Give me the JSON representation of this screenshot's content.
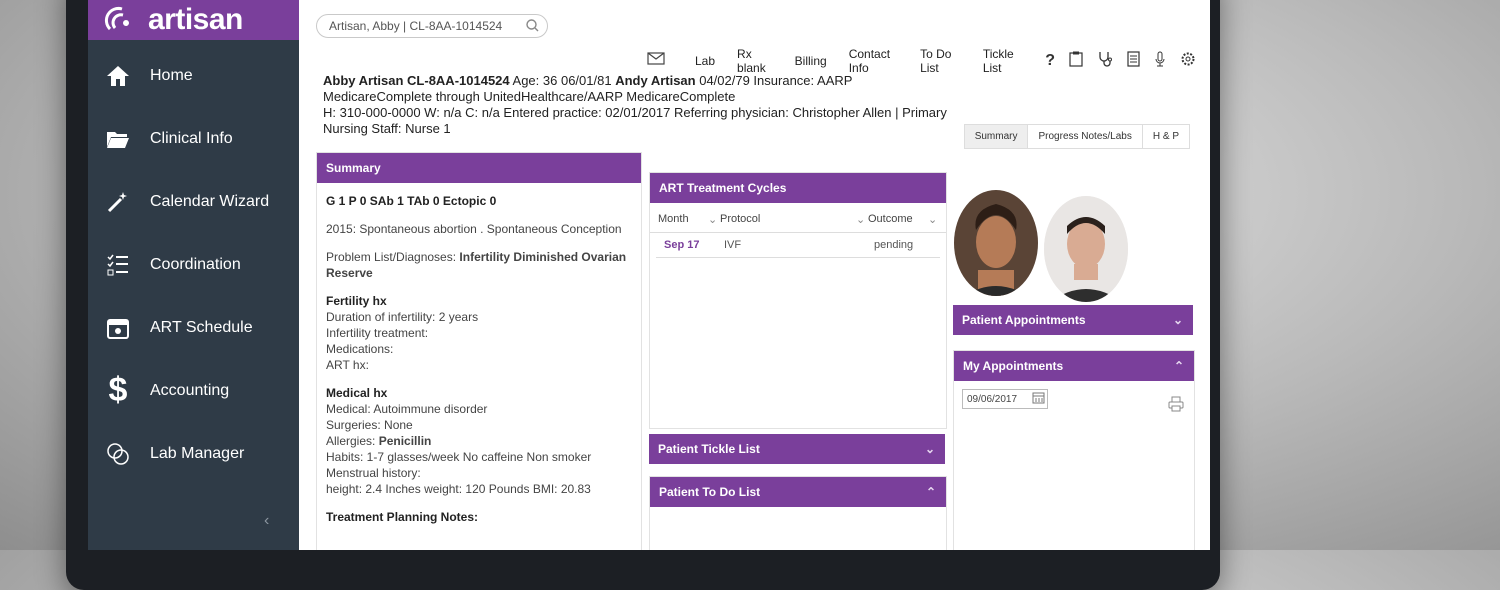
{
  "app": {
    "logo_text": "artisan",
    "accent": "#7a3f9b",
    "sidebar_bg": "#2f3b47"
  },
  "sidebar": {
    "items": [
      {
        "label": "Home",
        "icon": "home-icon"
      },
      {
        "label": "Clinical Info",
        "icon": "folder-icon"
      },
      {
        "label": "Calendar Wizard",
        "icon": "magic-wand-icon"
      },
      {
        "label": "Coordination",
        "icon": "checklist-icon"
      },
      {
        "label": "ART Schedule",
        "icon": "calendar-icon"
      },
      {
        "label": "Accounting",
        "icon": "dollar-icon"
      },
      {
        "label": "Lab Manager",
        "icon": "lab-icon"
      }
    ],
    "collapse_glyph": "‹"
  },
  "search": {
    "value": "Artisan, Abby | CL-8AA-1014524"
  },
  "topnav": {
    "items": [
      "Lab",
      "Rx blank",
      "Billing",
      "Contact Info",
      "To Do List",
      "Tickle List"
    ],
    "help": "?"
  },
  "patient": {
    "name_id": "Abby Artisan CL-8AA-1014524",
    "age_dob": " Age: 36 06/01/81 ",
    "partner": "Andy Artisan",
    "partner_dob_ins": " 04/02/79 Insurance: AARP",
    "line2": "MedicareComplete through UnitedHealthcare/AARP MedicareComplete",
    "line3": "H: 310-000-0000 W: n/a C: n/a Entered practice: 02/01/2017 Referring physician: Christopher Allen | Primary",
    "line4": "Nursing Staff: Nurse 1"
  },
  "view_tabs": [
    "Summary",
    "Progress Notes/Labs",
    "H & P"
  ],
  "summary": {
    "title": "Summary",
    "gravida": "G 1 P 0 SAb 1 TAb 0 Ectopic 0",
    "history": "2015: Spontaneous abortion . Spontaneous Conception",
    "problem_label": "Problem List/Diagnoses: ",
    "problem_value": "Infertility   Diminished Ovarian Reserve",
    "fertility_title": "Fertility hx",
    "fertility_lines": [
      "Duration of infertility: 2 years",
      "Infertility treatment:",
      "Medications:",
      "ART hx:"
    ],
    "medical_title": "Medical hx",
    "medical": "Medical: Autoimmune disorder",
    "surgeries": "Surgeries: None",
    "allergies_label": "Allergies: ",
    "allergies_value": "Penicillin",
    "habits": "Habits: 1-7 glasses/week No caffeine Non smoker",
    "menstrual": "Menstrual history:",
    "vitals": "height: 2.4 Inches weight: 120 Pounds BMI: 20.83",
    "treatment_title": "Treatment Planning Notes:"
  },
  "art_cycles": {
    "title": "ART Treatment Cycles",
    "columns": [
      "Month",
      "Protocol",
      "Outcome"
    ],
    "rows": [
      {
        "month": "Sep 17",
        "protocol": "IVF",
        "outcome": "pending"
      }
    ]
  },
  "tickle": {
    "title": "Patient Tickle List"
  },
  "todo": {
    "title": "Patient To Do List"
  },
  "appointments": {
    "patient_title": "Patient Appointments",
    "my_title": "My Appointments",
    "date": "09/06/2017"
  }
}
